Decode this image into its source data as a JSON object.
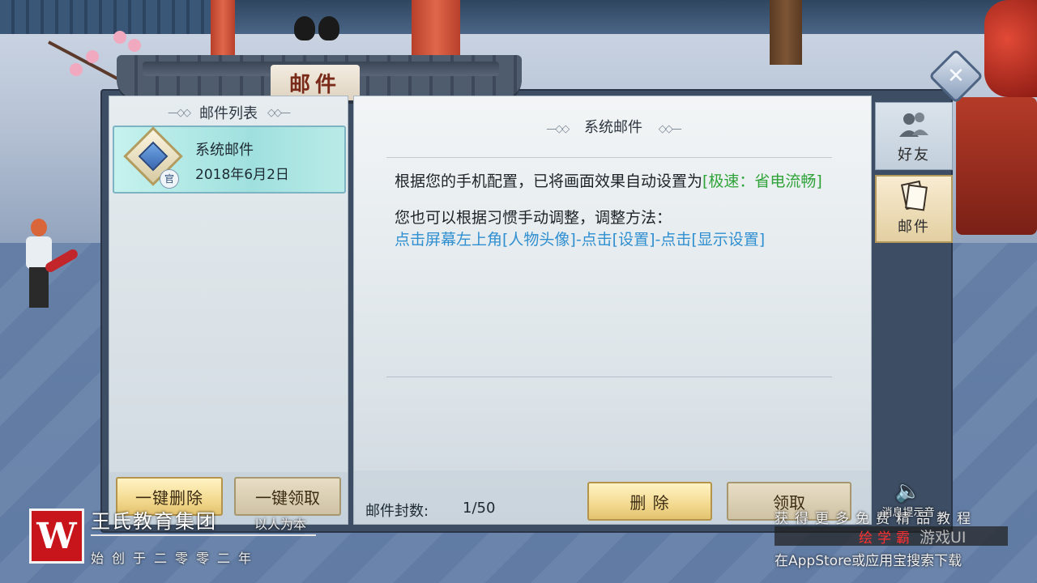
{
  "window": {
    "title": "邮件"
  },
  "list": {
    "header": "邮件列表",
    "items": [
      {
        "sender": "系统邮件",
        "date": "2018年6月2日",
        "tag": "官"
      }
    ],
    "delete_all_label": "一键删除",
    "claim_all_label": "一键领取"
  },
  "message": {
    "header": "系统邮件",
    "line1_prefix": "根据您的手机配置，已将画面效果自动设置为",
    "line1_highlight": "[极速：省电流畅]",
    "line2": "您也可以根据习惯手动调整，调整方法：",
    "line3": "点击屏幕左上角[人物头像]-点击[设置]-点击[显示设置]"
  },
  "footer": {
    "count_label": "邮件封数:",
    "count_value": "1/50",
    "delete_label": "删 除",
    "claim_label": "领取"
  },
  "tabs": [
    {
      "label": "好友",
      "icon": "friends-icon",
      "active": false
    },
    {
      "label": "邮件",
      "icon": "mail-icon",
      "active": true
    }
  ],
  "sound": {
    "label": "消息提示音",
    "icon": "speaker-icon"
  },
  "watermark": {
    "logo_letter": "W",
    "name": "王氏教育集团",
    "slogan": "以人为本",
    "since": "始创于二零零二年",
    "right_line1": "获得更多免费精品教程",
    "right_line2a": "绘学霸",
    "right_line2b": "游戏UI",
    "right_line3": "在AppStore或应用宝搜索下载"
  },
  "colors": {
    "highlight_green": "#2fa339",
    "instruction_blue": "#2f8fd0",
    "title_red": "#7a2a18",
    "button_gold": "#f3d98f"
  }
}
